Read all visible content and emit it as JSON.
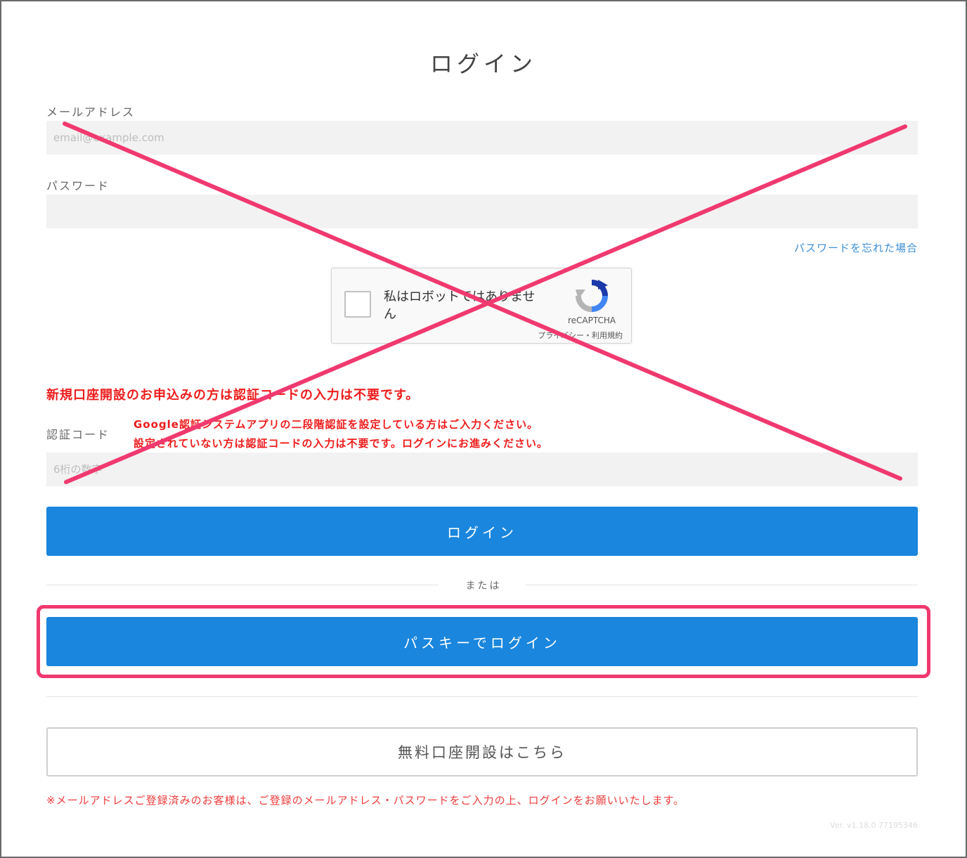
{
  "page": {
    "title": "ログイン",
    "email": {
      "label": "メールアドレス",
      "placeholder": "email@example.com",
      "value": ""
    },
    "password": {
      "label": "パスワード",
      "value": ""
    },
    "forgot_link": "パスワードを忘れた場合",
    "recaptcha": {
      "checkbox_label": "私はロボットではありません",
      "brand": "reCAPTCHA",
      "links": "プライバシー・利用規約"
    },
    "notice_new_account": "新規口座開設のお申込みの方は認証コードの入力は不要です。",
    "auth_code": {
      "label": "認証コード",
      "hint_line1": "Google認証システムアプリの二段階認証を設定している方はご入力ください。",
      "hint_line2": "設定されていない方は認証コードの入力は不要です。ログインにお進みください。",
      "placeholder": "6桁の数字",
      "value": ""
    },
    "login_button": "ログイン",
    "or_separator": "または",
    "passkey_button": "パスキーでログイン",
    "open_account_button": "無料口座開設はこちら",
    "footnote": "※メールアドレスご登録済みのお客様は、ご登録のメールアドレス・パスワードをご入力の上、ログインをお願いいたします。",
    "version": "Ver. v1.18.0 77195346"
  },
  "colors": {
    "primary_button": "#1a86dd",
    "link": "#3d8fd6",
    "notice_red": "#ee1c1c",
    "annotation_pink": "#f0396f",
    "input_bg": "#f2f2f2"
  }
}
